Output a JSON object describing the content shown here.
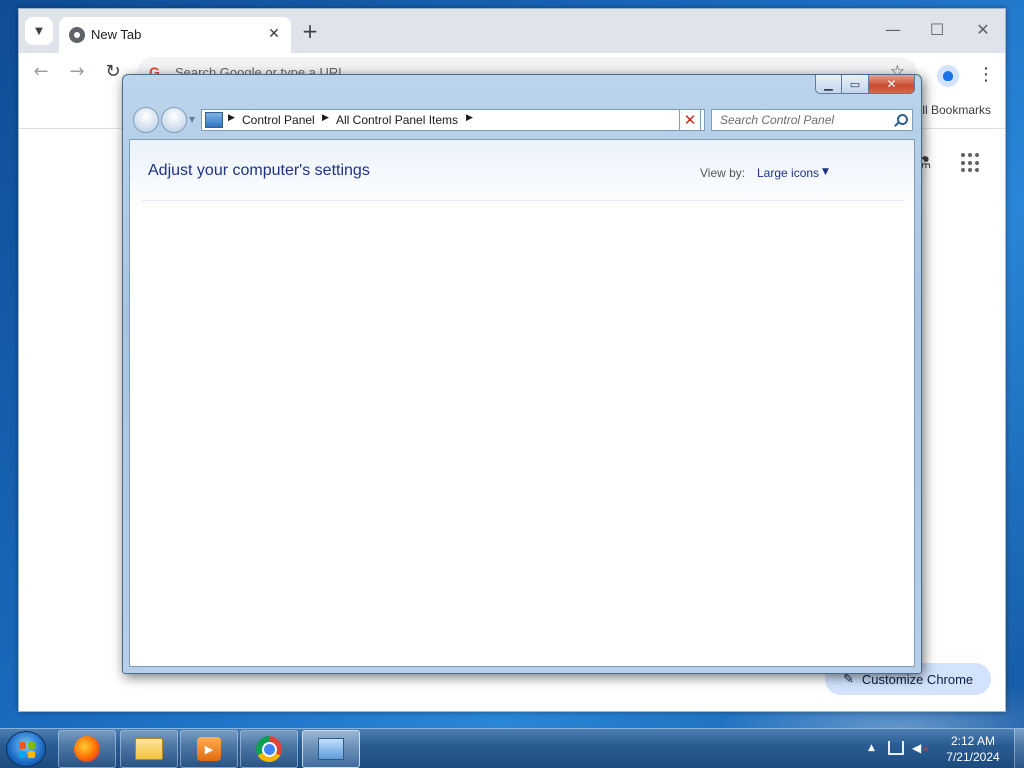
{
  "chrome": {
    "tab_title": "New Tab",
    "tab_close": "✕",
    "new_tab": "+",
    "minimize": "—",
    "maximize": "☐",
    "close": "✕",
    "back": "←",
    "forward": "→",
    "reload": "↻",
    "omnibox_logo": "G",
    "omnibox_placeholder": "Search Google or type a URL",
    "star": "☆",
    "kebab": "⋮",
    "all_bookmarks": "All Bookmarks",
    "labs": "⚗",
    "customize_icon": "✎",
    "customize_label": "Customize Chrome"
  },
  "control_panel": {
    "caption_min": "▁",
    "caption_max": "▭",
    "caption_close": "✕",
    "nav_dropdown": "▼",
    "breadcrumb": [
      "Control Panel",
      "All Control Panel Items"
    ],
    "breadcrumb_sep": "▶",
    "address_dropdown": "▼",
    "address_clear": "✕",
    "search_placeholder": "Search Control Panel",
    "heading": "Adjust your computer's settings",
    "view_by_label": "View by:",
    "view_by_value": "Large icons",
    "view_by_arrow": "▼"
  },
  "taskbar": {
    "media_glyph": "▶",
    "tray_arrow": "▲",
    "volume_glyph": "◀",
    "volume_mute": "✕",
    "clock_time": "2:12 AM",
    "clock_date": "7/21/2024"
  },
  "colors": {
    "start_flag": [
      "#f35325",
      "#81bc06",
      "#05a6f0",
      "#ffba08"
    ]
  }
}
